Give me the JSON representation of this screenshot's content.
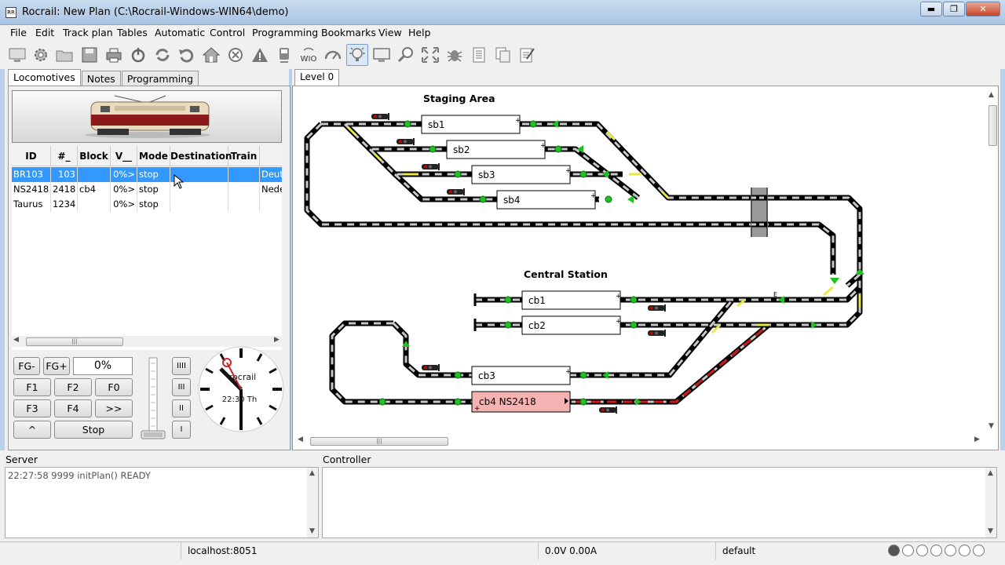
{
  "window": {
    "title": "Rocrail: New Plan (C:\\Rocrail-Windows-WIN64\\demo)",
    "minimize": "▬",
    "maximize": "❐",
    "close": "✕"
  },
  "menu": [
    "File",
    "Edit",
    "Track plan",
    "Tables",
    "Automatic",
    "Control",
    "Programming",
    "Bookmarks",
    "View",
    "Help"
  ],
  "toolbar_icons": [
    "connect-icon",
    "settings-icon",
    "open-icon",
    "save-icon",
    "print-icon",
    "power-icon",
    "refresh-icon",
    "undo-icon",
    "home-icon",
    "stop-all-icon",
    "warning-icon",
    "train-icon",
    "wio-icon",
    "speedometer-icon",
    "lightbulb-icon",
    "monitor-icon",
    "zoom-icon",
    "fullscreen-icon",
    "debug-icon",
    "list-icon",
    "copy-icon",
    "edit-icon"
  ],
  "toolbar_wio_label": "WIO",
  "left_tabs": [
    "Locomotives",
    "Notes",
    "Programming"
  ],
  "loco_table": {
    "headers": [
      "ID",
      "#_",
      "Block",
      "V__",
      "Mode",
      "Destination",
      "Train",
      ""
    ],
    "rows": [
      [
        "BR103",
        "103",
        "",
        "0%>",
        "stop",
        "",
        "",
        "Deuts"
      ],
      [
        "NS2418",
        "2418",
        "cb4",
        "0%>",
        "stop",
        "",
        "",
        "Neder"
      ],
      [
        "Taurus",
        "1234",
        "",
        "0%>",
        "stop",
        "",
        "",
        ""
      ]
    ]
  },
  "controls": {
    "fg_minus": "FG-",
    "fg_plus": "FG+",
    "speed": "0%",
    "f1": "F1",
    "f2": "F2",
    "f0": "F0",
    "f3": "F3",
    "f4": "F4",
    "fwd": ">>",
    "up": "^",
    "stop": "Stop",
    "gears": [
      "IIII",
      "III",
      "II",
      "I"
    ]
  },
  "clock": {
    "brand": "rocrail",
    "time": "22:30 Th"
  },
  "plan": {
    "level_tab": "Level 0",
    "labels": {
      "staging": "Staging Area",
      "central": "Central Station"
    },
    "blocks": {
      "sb1": "sb1",
      "sb2": "sb2",
      "sb3": "sb3",
      "sb4": "sb4",
      "cb1": "cb1",
      "cb2": "cb2",
      "cb3": "cb3",
      "cb4": "cb4 NS2418"
    },
    "plus": "+",
    "marker_e": "E"
  },
  "bottom": {
    "server_label": "Server",
    "controller_label": "Controller",
    "log": "22:27:58 9999 initPlan() READY"
  },
  "status": {
    "host": "localhost:8051",
    "power": "0.0V 0.00A",
    "workspace": "default"
  }
}
